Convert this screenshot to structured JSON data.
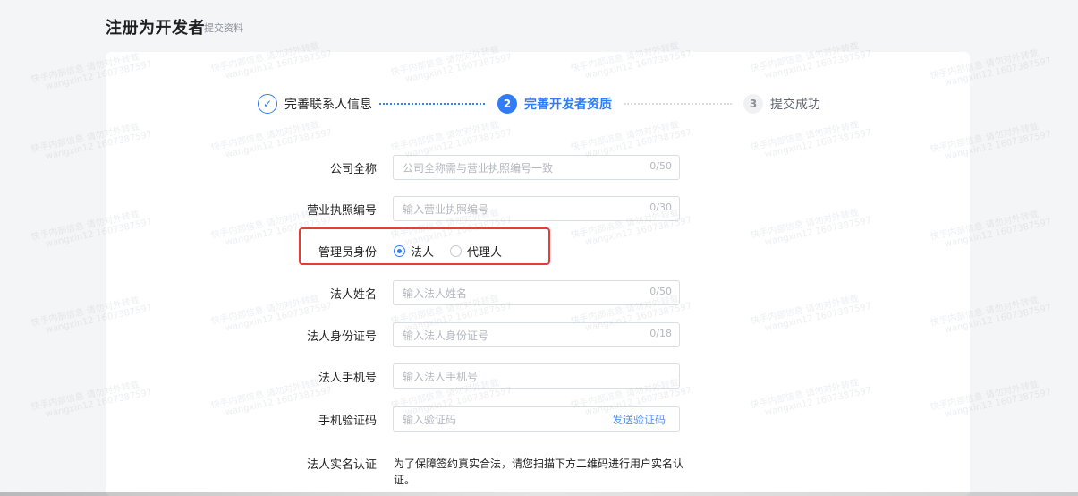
{
  "header": {
    "title": "注册为开发者",
    "subtitle": "提交资料"
  },
  "stepper": {
    "steps": [
      {
        "marker": "✓",
        "label": "完善联系人信息"
      },
      {
        "marker": "2",
        "label": "完善开发者资质"
      },
      {
        "marker": "3",
        "label": "提交成功"
      }
    ]
  },
  "form": {
    "company_name": {
      "label": "公司全称",
      "placeholder": "公司全称需与营业执照编号一致",
      "counter": "0/50"
    },
    "license_number": {
      "label": "营业执照编号",
      "placeholder": "输入营业执照编号",
      "counter": "0/30"
    },
    "admin_identity": {
      "label": "管理员身份",
      "options": [
        "法人",
        "代理人"
      ],
      "selected": "法人"
    },
    "legal_name": {
      "label": "法人姓名",
      "placeholder": "输入法人姓名",
      "counter": "0/50"
    },
    "legal_id": {
      "label": "法人身份证号",
      "placeholder": "输入法人身份证号",
      "counter": "0/18"
    },
    "legal_phone": {
      "label": "法人手机号",
      "placeholder": "输入法人手机号"
    },
    "phone_code": {
      "label": "手机验证码",
      "placeholder": "输入验证码",
      "action": "发送验证码"
    },
    "real_name_verify": {
      "label": "法人实名认证",
      "description": "为了保障签约真实合法，请您扫描下方二维码进行用户实名认证。"
    }
  },
  "watermark": {
    "line1": "快手内部信息 请勿对外转载",
    "line2": "wangxin12 1607387597"
  },
  "colors": {
    "primary": "#2f7cf6",
    "highlight": "#e83b37",
    "background": "#f4f5f7"
  }
}
